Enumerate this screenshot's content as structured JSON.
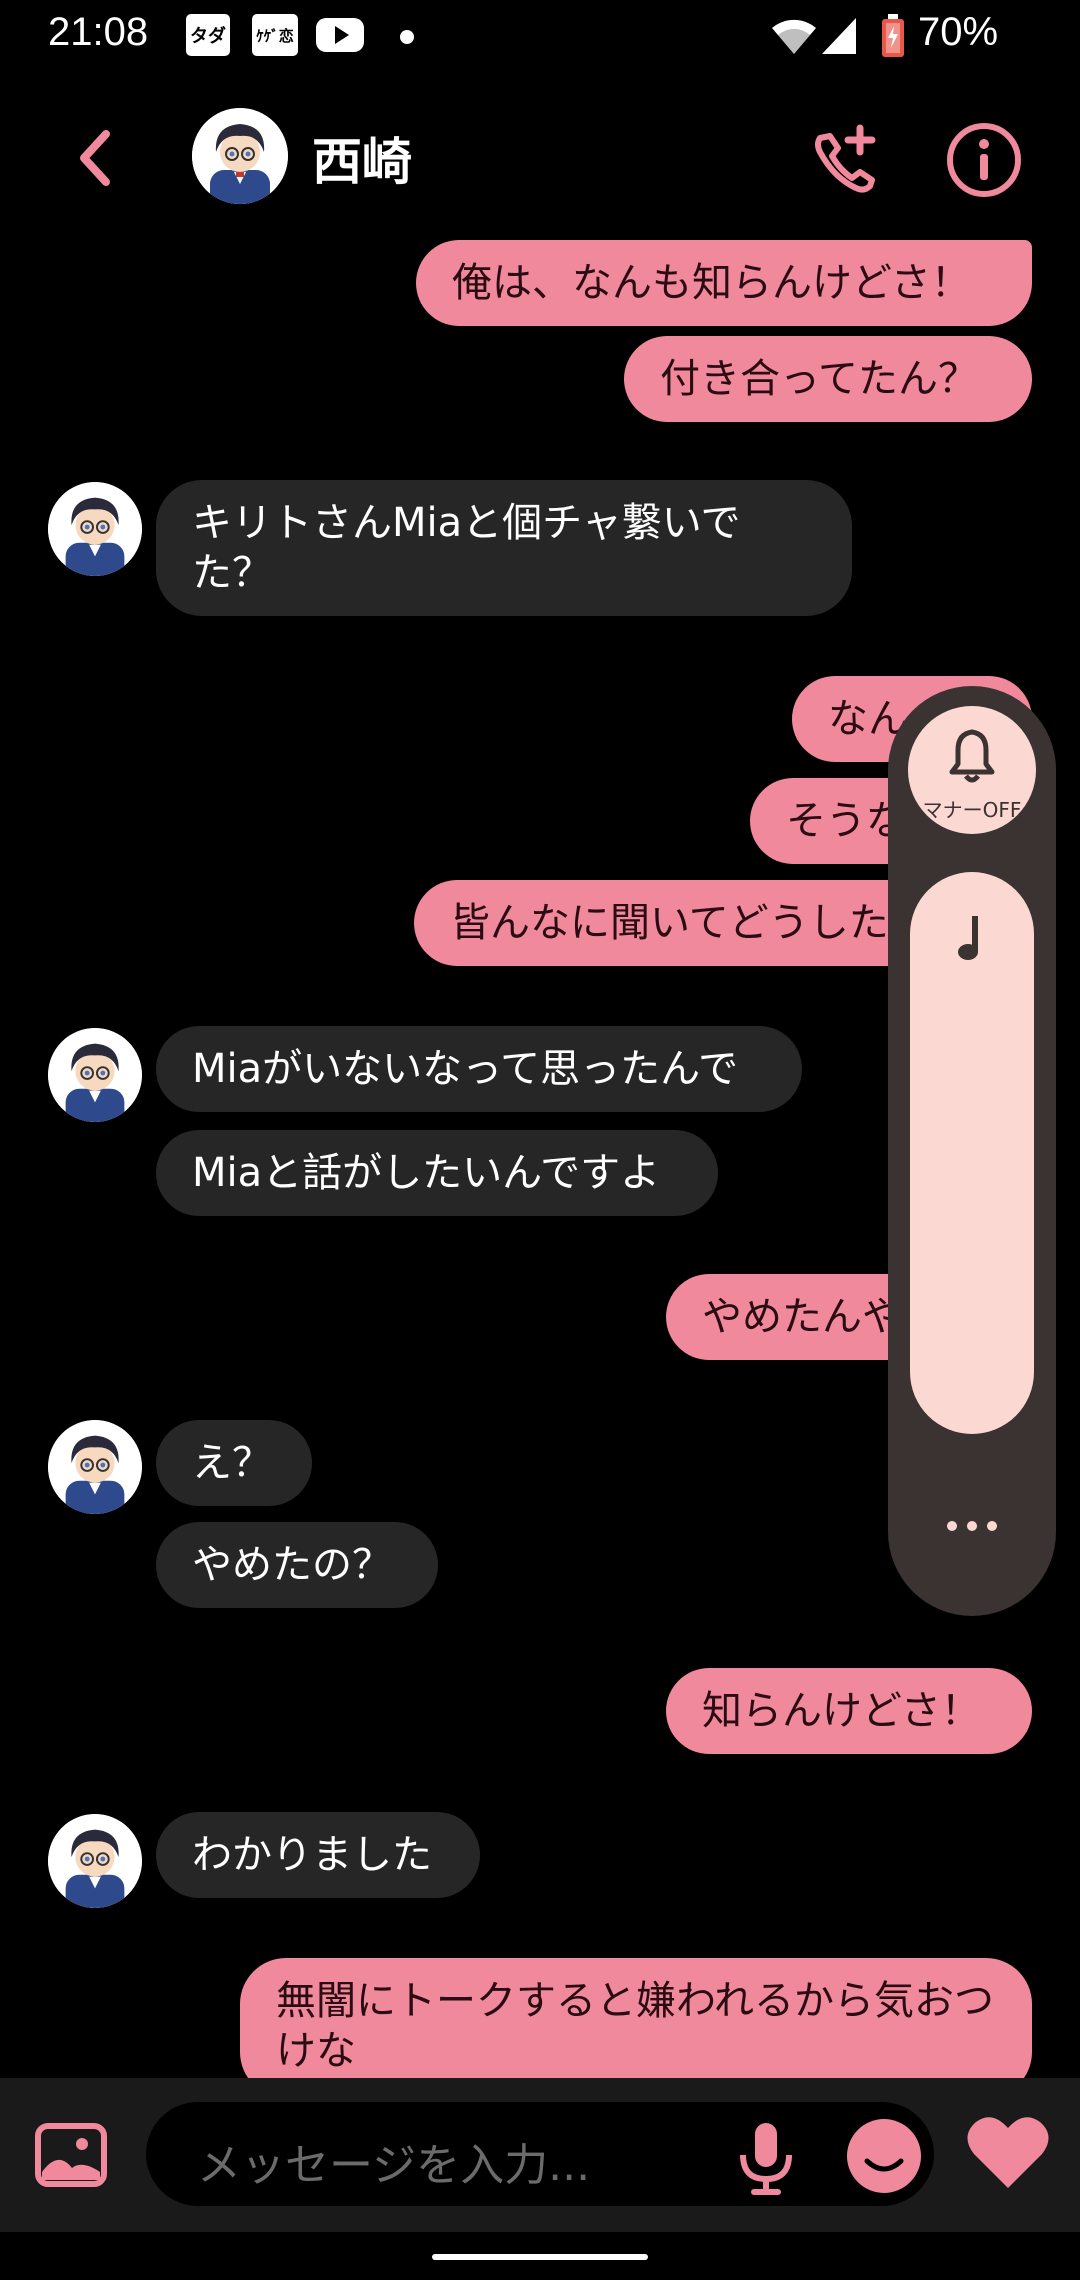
{
  "status_bar": {
    "time": "21:08",
    "notification_icons": [
      "タダ",
      "ｹｹﾞ恋",
      "youtube-icon"
    ],
    "battery": "70%"
  },
  "header": {
    "title": "西崎",
    "icons": [
      "back-chevron-icon",
      "add-call-icon",
      "info-icon"
    ]
  },
  "messages": [
    {
      "dir": "out",
      "text": "俺は、なんも知らんけどさ！"
    },
    {
      "dir": "out",
      "text": "付き合ってたん？"
    },
    {
      "dir": "in",
      "text": "キリトさんMiaと個チャ繋いでた？"
    },
    {
      "dir": "out",
      "text": "なん"
    },
    {
      "dir": "out",
      "text": "そうな"
    },
    {
      "dir": "out",
      "text": "皆んなに聞いてどうした"
    },
    {
      "dir": "in",
      "text": "Miaがいないなって思ったんで"
    },
    {
      "dir": "in",
      "text": "Miaと話がしたいんですよ"
    },
    {
      "dir": "out",
      "text": "やめたんや"
    },
    {
      "dir": "in",
      "text": "え？"
    },
    {
      "dir": "in",
      "text": "やめたの？"
    },
    {
      "dir": "out",
      "text": "知らんけどさ！"
    },
    {
      "dir": "in",
      "text": "わかりました"
    },
    {
      "dir": "out",
      "text": "無闇にトークすると嫌われるから気おつけな"
    }
  ],
  "volume_panel": {
    "ringer_label": "マナーOFF",
    "icons": [
      "bell-icon",
      "music-note-icon",
      "more-icon"
    ]
  },
  "input": {
    "placeholder": "メッセージを入力..."
  },
  "colors": {
    "accent": "#f0899b",
    "incoming_bubble": "#262626",
    "panel": "#3a3332",
    "panel_light": "#fcd8d2"
  }
}
